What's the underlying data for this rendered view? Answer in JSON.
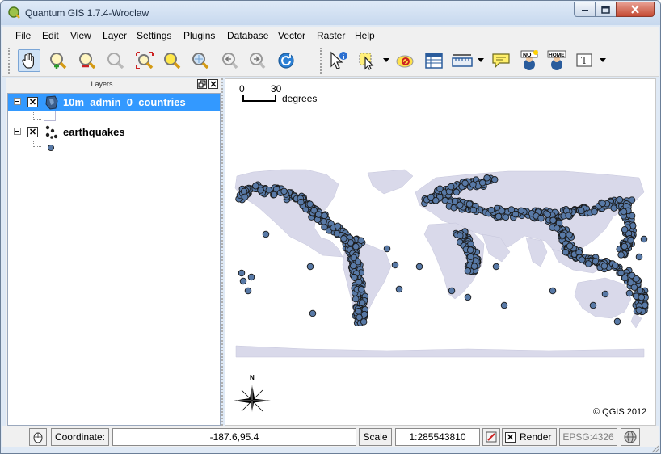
{
  "window": {
    "title": "Quantum GIS 1.7.4-Wroclaw"
  },
  "menu": [
    "File",
    "Edit",
    "View",
    "Layer",
    "Settings",
    "Plugins",
    "Database",
    "Vector",
    "Raster",
    "Help"
  ],
  "toolbar": {
    "tools": [
      "pan-map",
      "zoom-in",
      "zoom-out",
      "zoom-actual-size",
      "zoom-full-extent",
      "zoom-to-selection",
      "zoom-to-layer",
      "zoom-last",
      "zoom-next",
      "refresh",
      "identify-features",
      "select-features",
      "deselect-all",
      "open-attribute-table",
      "measure-line",
      "map-tips",
      "new-bookmark",
      "show-bookmarks",
      "text-annotation"
    ],
    "bookmark_new_badge": "NO",
    "bookmark_home_badge": "HOME",
    "text_annotation_glyph": "T"
  },
  "layers_panel": {
    "title": "Layers",
    "layers": [
      {
        "name": "10m_admin_0_countries",
        "visible": true,
        "selected": true,
        "symbol_color": "#d9d9ea"
      },
      {
        "name": "earthquakes",
        "visible": true,
        "selected": false,
        "symbol_color": "#5879a6"
      }
    ]
  },
  "map": {
    "scale_bar": {
      "start": "0",
      "end": "30",
      "units": "degrees"
    },
    "north_label": "N",
    "copyright": "© QGIS 2012",
    "land_color": "#d9d9ea",
    "point_color": "#5879a6"
  },
  "statusbar": {
    "coordinate_label": "Coordinate:",
    "coordinate_value": "-187.6,95.4",
    "scale_label": "Scale",
    "scale_value": "1:285543810",
    "render_label": "Render",
    "crs": "EPSG:4326"
  }
}
